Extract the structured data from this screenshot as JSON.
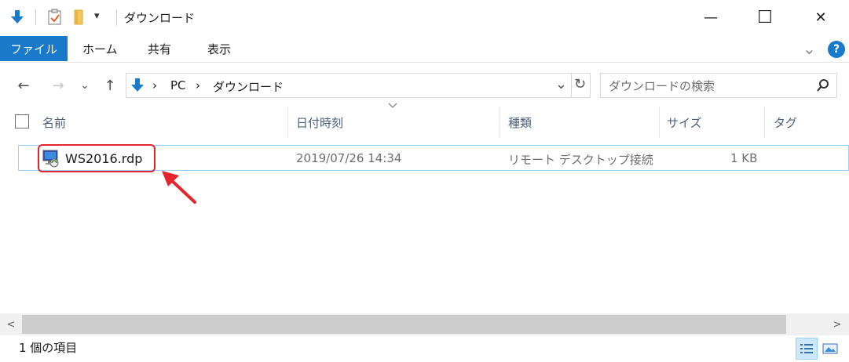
{
  "window": {
    "title": "ダウンロード",
    "qat_dropdown": "▾",
    "minimize": "—",
    "maximize": "☐",
    "close": "✕"
  },
  "ribbon": {
    "tabs": [
      "ファイル",
      "ホーム",
      "共有",
      "表示"
    ],
    "expand": "⌄",
    "help": "?",
    "active_color": "#1979ca"
  },
  "nav": {
    "back": "←",
    "forward": "→",
    "recent": "⌄",
    "up": "↑",
    "breadcrumb": [
      "PC",
      "ダウンロード"
    ],
    "crumb_sep": "›",
    "address_dropdown": "⌄",
    "refresh": "↻",
    "search_placeholder": "ダウンロードの検索"
  },
  "columns": [
    "名前",
    "日付時刻",
    "種類",
    "サイズ",
    "タグ"
  ],
  "files": [
    {
      "name": "WS2016.rdp",
      "date": "2019/07/26 14:34",
      "type": "リモート デスクトップ接続",
      "size": "1 KB",
      "tags": ""
    }
  ],
  "statusbar": {
    "count": "1 個の項目"
  },
  "scrollbar": {
    "left": "<",
    "right": ">"
  },
  "colors": {
    "accent": "#1979ca",
    "selection_border": "#99d1ff",
    "annotation": "#e6242b"
  }
}
